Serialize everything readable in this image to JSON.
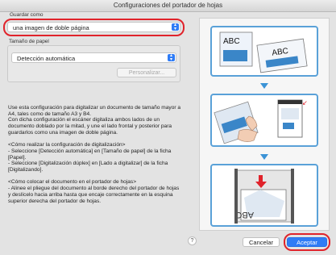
{
  "window": {
    "title": "Configuraciones del portador de hojas"
  },
  "save_as": {
    "label": "Guardar como",
    "value": "una imagen de doble página"
  },
  "paper_size": {
    "label": "Tamaño de papel",
    "value": "Detección automática",
    "customize_label": "Personalizar..."
  },
  "description": "Use esta configuración para digitalizar un documento de tamaño mayor a A4, tales como de tamaño A3 y B4.\nCon dicha configuración el escáner digitaliza ambos lados de un documento doblado por la mitad, y une el lado frontal y posterior para guardarlos como una imagen de doble página.\n\n<Cómo realizar la configuración de digitalización>\n- Seleccione [Detección automática] en [Tamaño de papel] de la ficha [Papel].\n- Seleccione [Digitalización dúplex] en [Lado a digitalizar] de la ficha [Digitalizando].\n\n<Cómo colocar el documento en el portador de hojas>\n- Alinee el pliegue del documento al borde derecho del portador de hojas y deslícelo hacia arriba hasta que encaje correctamente en la esquina superior derecha del portador de hojas.",
  "illustration": {
    "text_abc_1": "ABC",
    "text_abc_2": "ABC",
    "text_abc_3": "ABC"
  },
  "help_label": "?",
  "buttons": {
    "cancel": "Cancelar",
    "ok": "Aceptar"
  }
}
